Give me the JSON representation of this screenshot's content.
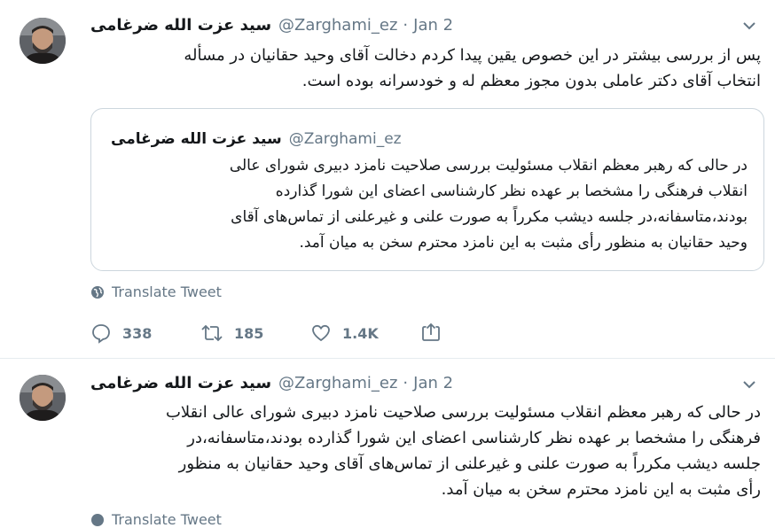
{
  "tweets": [
    {
      "name": "سید عزت الله ضرغامی",
      "handle": "@Zarghami_ez",
      "dot": "·",
      "date": "Jan 2",
      "text": "پس از بررسی بیشتر در این خصوص یقین پیدا کردم دخالت آقای وحید حقانیان در مسأله\nانتخاب آقای دکتر عاملی بدون مجوز معظم له و خودسرانه بوده است.",
      "quoted": {
        "name": "سید عزت الله ضرغامی",
        "handle": "@Zarghami_ez",
        "text": "در حالی که رهبر معظم انقلاب مسئولیت بررسی صلاحیت نامزد دبیری شورای عالی\nانقلاب فرهنگی را مشخصا بر عهده نظر کارشناسی اعضای این شورا گذارده\nبودند،متاسفانه،در جلسه دیشب مکرراً به صورت علنی و غیرعلنی از تماس‌های آقای\nوحید حقانیان به منظور رأی مثبت به این نامزد محترم سخن به میان آمد."
      },
      "translate_label": "Translate Tweet",
      "actions": {
        "reply_count": "338",
        "retweet_count": "185",
        "like_count": "1.4K"
      }
    },
    {
      "name": "سید عزت الله ضرغامی",
      "handle": "@Zarghami_ez",
      "dot": "·",
      "date": "Jan 2",
      "text": "در حالی که رهبر معظم انقلاب مسئولیت بررسی صلاحیت نامزد دبیری شورای عالی انقلاب\nفرهنگی را مشخصا بر عهده نظر کارشناسی اعضای این شورا گذارده بودند،متاسفانه،در\nجلسه دیشب مکرراً به صورت علنی و غیرعلنی از تماس‌های آقای وحید حقانیان به منظور\nرأی مثبت به این نامزد محترم سخن به میان آمد.",
      "translate_label": "Translate Tweet"
    }
  ],
  "colors": {
    "text": "#14171a",
    "secondary": "#657786",
    "border": "#ccd6dd"
  },
  "icons": [
    "avatar",
    "chevron-down-icon",
    "globe-icon",
    "reply-icon",
    "retweet-icon",
    "like-icon",
    "share-icon"
  ]
}
